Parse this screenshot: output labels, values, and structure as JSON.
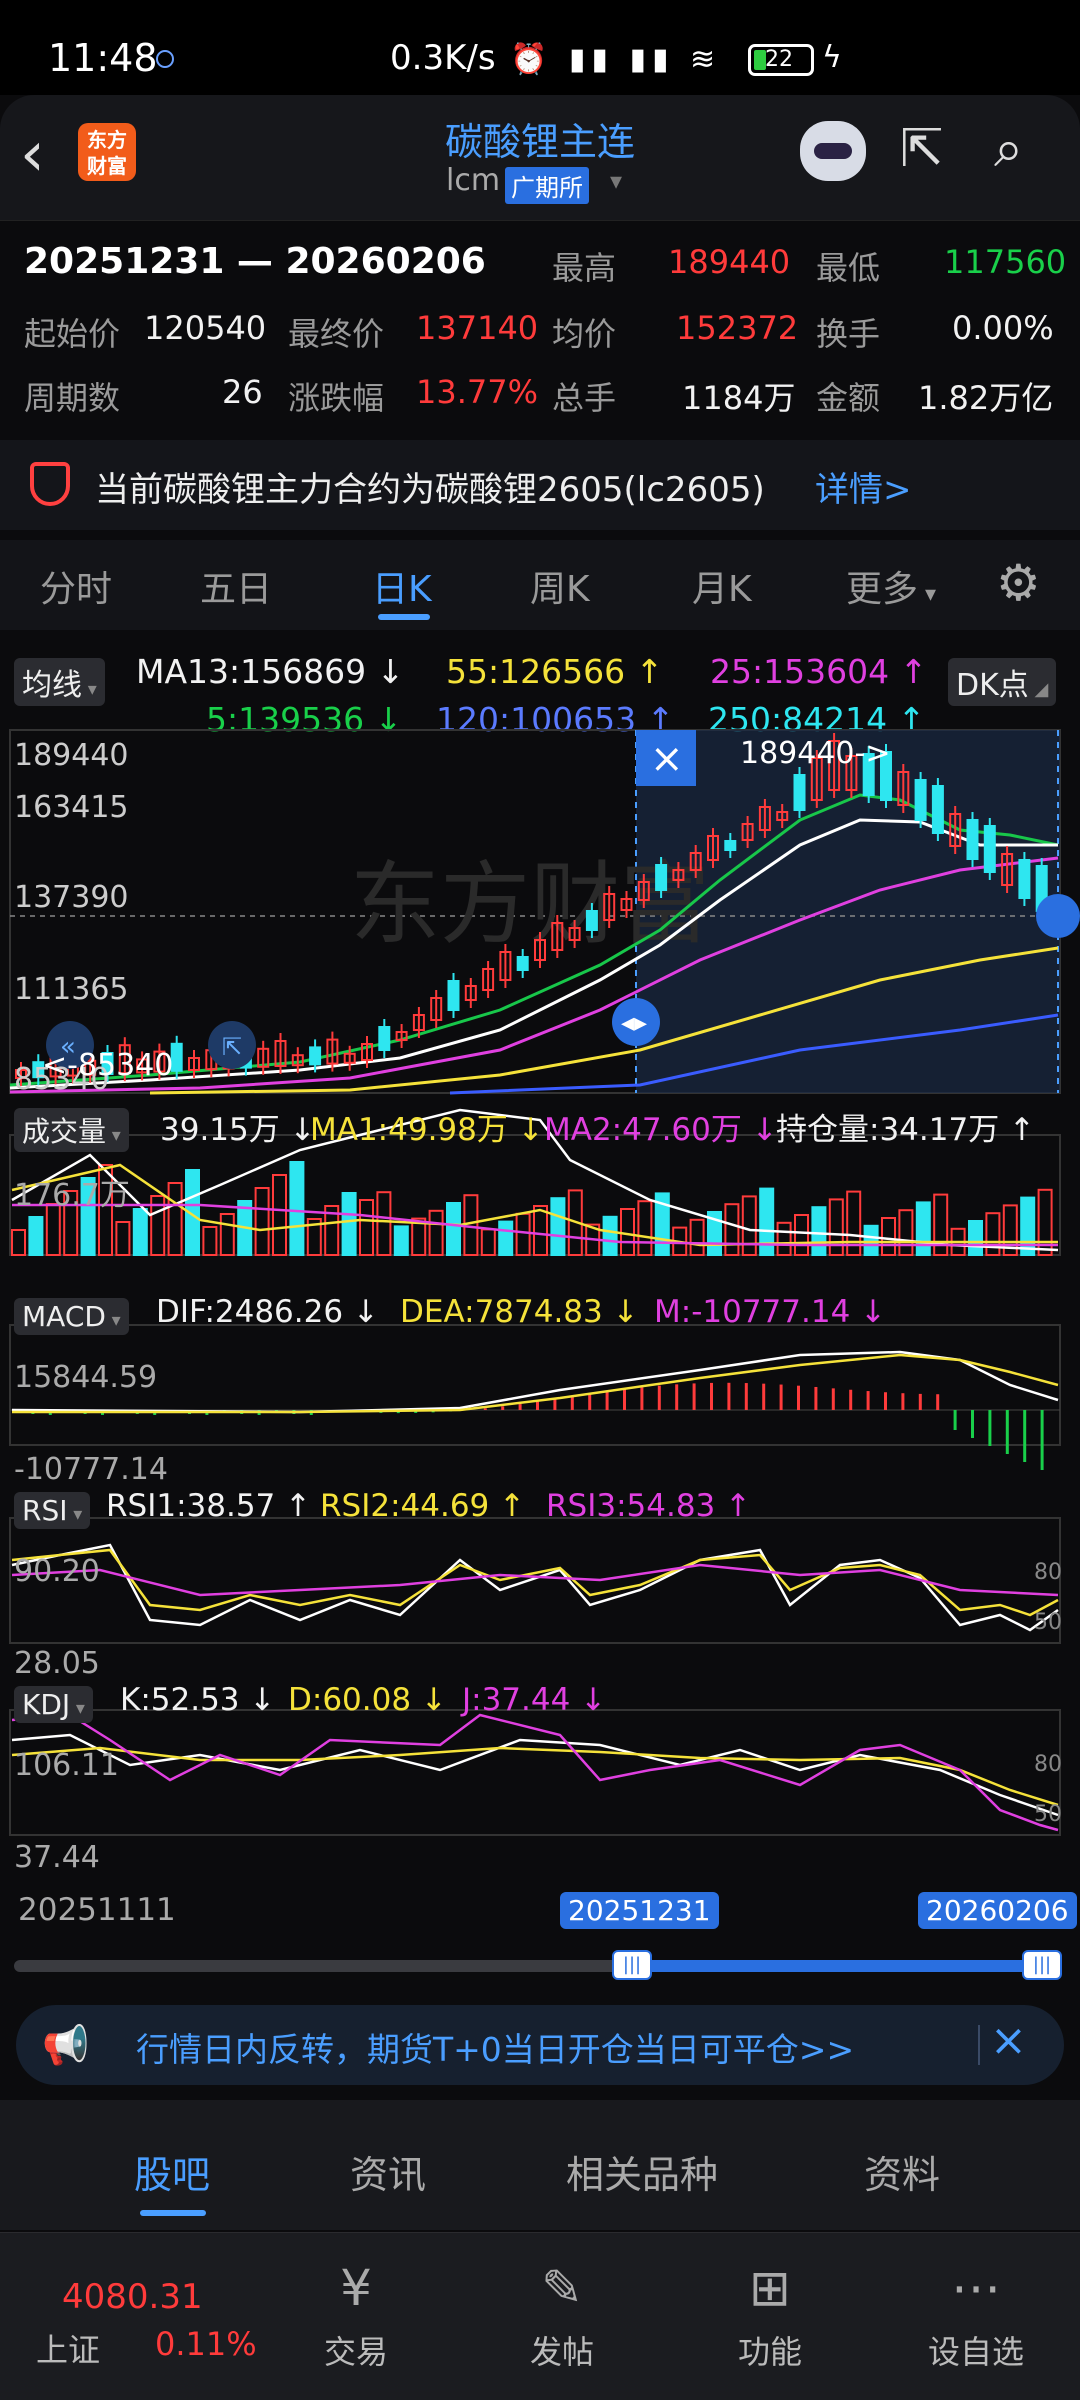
{
  "status": {
    "time": "11:48",
    "speed": "0.3K/s",
    "battery": "22"
  },
  "header": {
    "logo_text_line1": "东方",
    "logo_text_line2": "财富",
    "title": "碳酸锂主连",
    "code": "lcm",
    "exchange": "广期所"
  },
  "info": {
    "range": "20251231 — 20260206",
    "high_label": "最高",
    "high": "189440",
    "low_label": "最低",
    "low": "117560",
    "start_label": "起始价",
    "start": "120540",
    "final_label": "最终价",
    "final": "137140",
    "avg_label": "均价",
    "avg": "152372",
    "turnover_label": "换手",
    "turnover": "0.00%",
    "periods_label": "周期数",
    "periods": "26",
    "change_label": "涨跌幅",
    "change": "13.77%",
    "totalvol_label": "总手",
    "totalvol": "1184万",
    "amount_label": "金额",
    "amount": "1.82万亿"
  },
  "notice": {
    "text": "当前碳酸锂主力合约为碳酸锂2605(lc2605)",
    "detail": "详情>"
  },
  "tabs": [
    "分时",
    "五日",
    "日K",
    "周K",
    "月K",
    "更多"
  ],
  "active_tab": "日K",
  "chart": {
    "ma_button": "均线",
    "dk_button": "DK点",
    "ma13": "MA13:156869 ↓",
    "ma55": "55:126566 ↑",
    "ma25": "25:153604 ↑",
    "ma5": "5:139536 ↓",
    "ma120": "120:100653 ↑",
    "ma250": "250:84214 ↑",
    "price_axis": [
      "189440",
      "163415",
      "137390",
      "111365",
      "85340"
    ],
    "high_marker": "189440->",
    "low_marker": "<-85340",
    "volume_button": "成交量",
    "volume": "39.15万 ↓",
    "vol_ma1": "MA1:49.98万 ↓",
    "vol_ma2": "MA2:47.60万 ↓",
    "open_interest": "持仓量:34.17万 ↑",
    "volume_axis_top": "176.7万",
    "macd_button": "MACD",
    "dif": "DIF:2486.26 ↓",
    "dea": "DEA:7874.83 ↓",
    "m": "M:-10777.14 ↓",
    "macd_axis_top": "15844.59",
    "macd_axis_bottom": "-10777.14",
    "rsi_button": "RSI",
    "rsi1": "RSI1:38.57 ↑",
    "rsi2": "RSI2:44.69 ↑",
    "rsi3": "RSI3:54.83 ↑",
    "rsi_axis_top": "90.20",
    "rsi_axis_bottom": "28.05",
    "rsi_right_80": "80",
    "rsi_right_50": "50",
    "kdj_button": "KDJ",
    "k": "K:52.53 ↓",
    "d": "D:60.08 ↓",
    "j": "J:37.44 ↓",
    "kdj_axis_top": "106.11",
    "kdj_axis_bottom": "37.44",
    "kdj_right_80": "80",
    "kdj_right_50": "50",
    "date_start": "20251111",
    "date_sel_start": "20251231",
    "date_sel_end": "20260206",
    "watermark": "东方财富"
  },
  "banner": {
    "text": "行情日内反转，期货T+0当日开仓当日可平仓>>"
  },
  "subtabs": [
    "股吧",
    "资讯",
    "相关品种",
    "资料"
  ],
  "bottombar": {
    "index_value": "4080.31",
    "index_name": "上证",
    "index_pct": "0.11%",
    "nav": [
      "交易",
      "发帖",
      "功能",
      "设自选"
    ]
  }
}
